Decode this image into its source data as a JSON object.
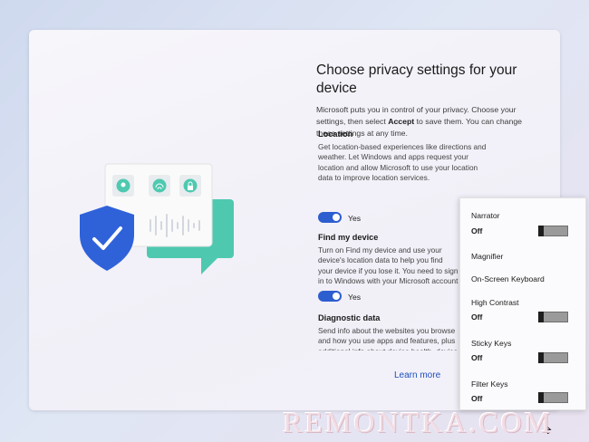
{
  "dialog": {
    "title": "Choose privacy settings for your device",
    "intro_before": "Microsoft puts you in control of your privacy. Choose your settings, then select ",
    "intro_bold": "Accept",
    "intro_after": " to save them. You can change these settings at any time.",
    "sections": [
      {
        "heading": "Location",
        "description": "Get location-based experiences like directions and weather. Let Windows and apps request your location and allow Microsoft to use your location data to improve location services.",
        "toggle_state": "Yes"
      },
      {
        "heading": "Find my device",
        "description": "Turn on Find my device and use your device's location data to help you find your device if you lose it. You need to sign in to Windows with your Microsoft account to use this feature.",
        "toggle_state": "Yes"
      },
      {
        "heading": "Diagnostic data",
        "description": "Send info about the websites you browse and how you use apps and features, plus additional info about device health, device activity, and enhanced error reporting."
      }
    ],
    "learn_more": "Learn more"
  },
  "accessibility_panel": {
    "items": [
      {
        "label": "Narrator",
        "value": "Off",
        "has_toggle": true
      },
      {
        "label": "Magnifier"
      },
      {
        "label": "On-Screen Keyboard"
      },
      {
        "label": "High Contrast",
        "value": "Off",
        "has_toggle": true
      },
      {
        "label": "Sticky Keys",
        "value": "Off",
        "has_toggle": true
      },
      {
        "label": "Filter Keys",
        "value": "Off",
        "has_toggle": true
      }
    ]
  },
  "watermark": "REMONTKA.COM",
  "colors": {
    "accent": "#2d5ecf",
    "shield": "#2f62d9",
    "bubble": "#4ec9b0",
    "link": "#1f4fbf"
  },
  "icons": [
    "location-pin-icon",
    "fingerprint-icon",
    "lock-icon",
    "shield-check-icon",
    "cursor-icon"
  ]
}
